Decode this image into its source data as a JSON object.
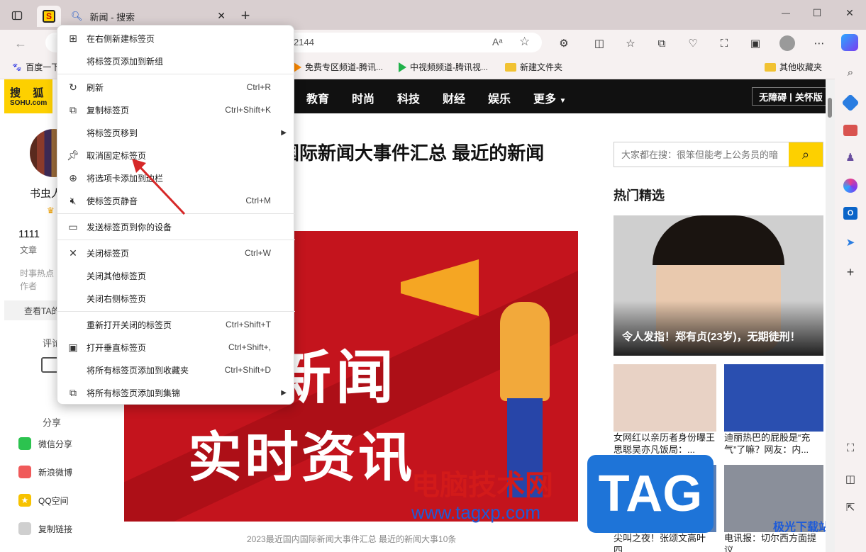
{
  "tabs": {
    "active_title": "新闻 - 搜索",
    "new_tab": "+"
  },
  "window": {
    "minimize": "—",
    "maximize": "☐",
    "close": "✕"
  },
  "address": {
    "url_fragment": "2144"
  },
  "bookmarks": [
    {
      "label": "百度一下"
    },
    {
      "label": "免费专区频道-腾讯..."
    },
    {
      "label": "中视频频道-腾讯视..."
    },
    {
      "label": "新建文件夹"
    }
  ],
  "other_bookmarks": "其他收藏夹",
  "context_menu": {
    "items": [
      {
        "label": "在右侧新建标签页",
        "shortcut": "",
        "icon": "new-tab-icon"
      },
      {
        "label": "将标签页添加到新组",
        "shortcut": "",
        "icon": ""
      },
      {
        "label": "刷新",
        "shortcut": "Ctrl+R",
        "icon": "refresh-icon"
      },
      {
        "label": "复制标签页",
        "shortcut": "Ctrl+Shift+K",
        "icon": "duplicate-icon"
      },
      {
        "label": "将标签页移到",
        "shortcut": "",
        "icon": "",
        "submenu": true
      },
      {
        "label": "取消固定标签页",
        "shortcut": "",
        "icon": "pin-icon"
      },
      {
        "label": "将选项卡添加到边栏",
        "shortcut": "",
        "icon": "sidebar-add-icon"
      },
      {
        "label": "使标签页静音",
        "shortcut": "Ctrl+M",
        "icon": "mute-icon"
      },
      {
        "label": "发送标签页到你的设备",
        "shortcut": "",
        "icon": "send-device-icon"
      },
      {
        "label": "关闭标签页",
        "shortcut": "Ctrl+W",
        "icon": "close-icon"
      },
      {
        "label": "关闭其他标签页",
        "shortcut": "",
        "icon": ""
      },
      {
        "label": "关闭右侧标签页",
        "shortcut": "",
        "icon": ""
      },
      {
        "label": "重新打开关闭的标签页",
        "shortcut": "Ctrl+Shift+T",
        "icon": ""
      },
      {
        "label": "打开垂直标签页",
        "shortcut": "Ctrl+Shift+,",
        "icon": "vertical-tabs-icon"
      },
      {
        "label": "将所有标签页添加到收藏夹",
        "shortcut": "Ctrl+Shift+D",
        "icon": ""
      },
      {
        "label": "将所有标签页添加到集锦",
        "shortcut": "",
        "icon": "collections-icon",
        "submenu": true
      }
    ]
  },
  "sohu": {
    "logo_top": "搜  狐",
    "logo_bottom": "SOHU.com"
  },
  "nav": [
    "教育",
    "时尚",
    "科技",
    "财经",
    "娱乐",
    "更多"
  ],
  "accessibility": "无障碍",
  "care": "关怀版",
  "author": {
    "name_fragment": "书虫人",
    "articles_count": "1111",
    "articles_label": "文章",
    "desc_line1": "时事热点",
    "desc_line2": "作者",
    "view_button": "查看TA的"
  },
  "comment_label": "评论",
  "share": {
    "title": "分享",
    "items": [
      "微信分享",
      "新浪微博",
      "QQ空间",
      "复制链接"
    ]
  },
  "article": {
    "headline": "国际新闻大事件汇总 最近的新闻",
    "image_text_1": "新闻",
    "image_text_2": "实时资讯",
    "caption": "2023最近国内国际新闻大事件汇总 最近的新闻大事10条"
  },
  "search": {
    "placeholder": "大家都在搜：很笨但能考上公务员的暗"
  },
  "hot": {
    "title": "热门精选",
    "main_caption": "令人发指！郑有贞(23岁)，无期徒刑！",
    "cards": [
      {
        "text": "女网红以亲历者身份曝王思聪吴亦凡饭局：..."
      },
      {
        "text": "迪丽热巴的屁股是“充气”了嘛？网友：内..."
      },
      {
        "text": "尖叫之夜！张颂文高叶四..."
      },
      {
        "text": "电讯报：切尔西方面提议..."
      }
    ]
  },
  "watermark": {
    "line1": "电脑技术网",
    "line2": "www.tagxp.com",
    "tag": "TAG",
    "corner": "极光下载站"
  },
  "colors": {
    "accent_yellow": "#fdd000",
    "nav_black": "#111111",
    "banner_red": "#c4141d",
    "pin_arrow": "#d62828"
  }
}
